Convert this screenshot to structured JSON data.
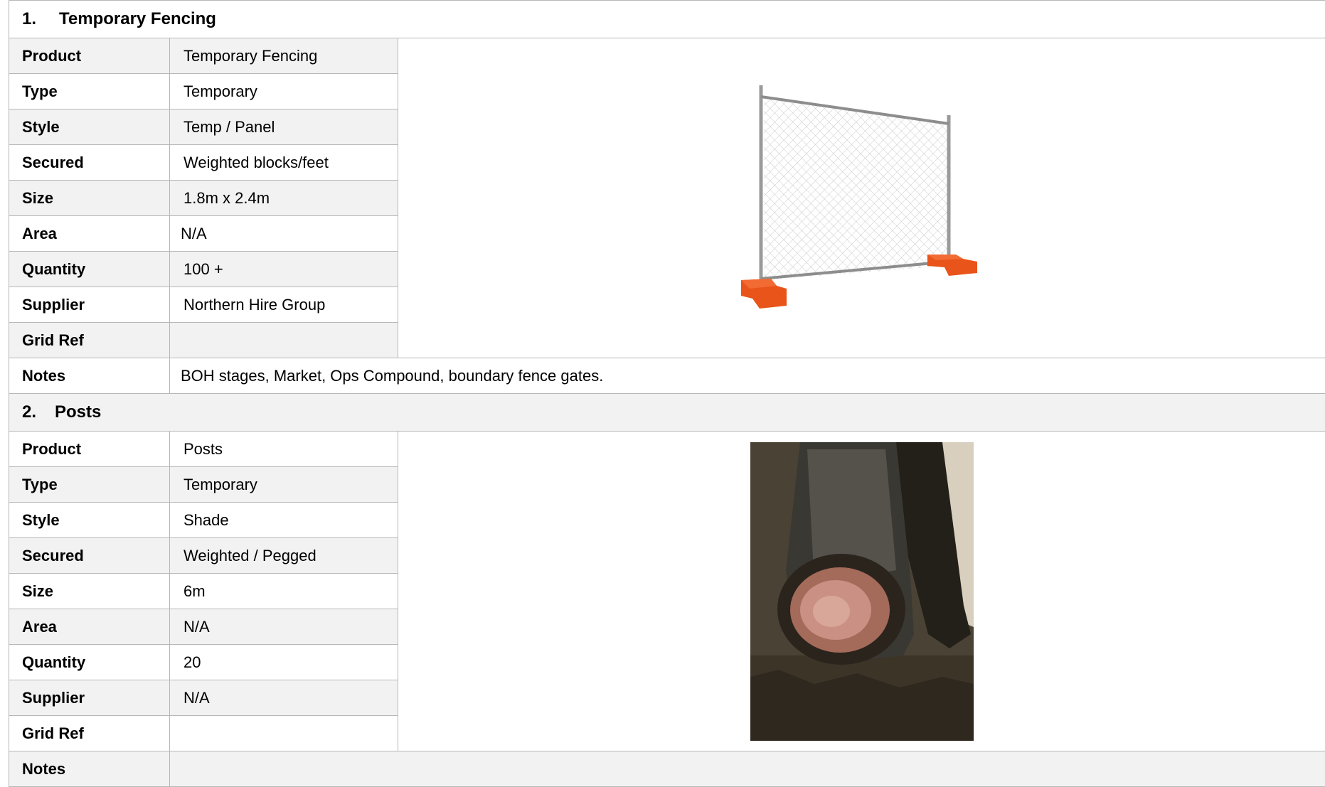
{
  "sections": [
    {
      "number": "1.",
      "title": "Temporary Fencing",
      "fields": [
        {
          "label": "Product",
          "value": "Temporary Fencing"
        },
        {
          "label": "Type",
          "value": "Temporary"
        },
        {
          "label": "Style",
          "value": "Temp / Panel"
        },
        {
          "label": "Secured",
          "value": "Weighted blocks/feet"
        },
        {
          "label": "Size",
          "value": "1.8m x 2.4m"
        },
        {
          "label": "Area",
          "value": "N/A"
        },
        {
          "label": "Quantity",
          "value": "100 +"
        },
        {
          "label": "Supplier",
          "value": "Northern Hire Group"
        },
        {
          "label": "Grid Ref",
          "value": ""
        }
      ],
      "notes_label": "Notes",
      "notes": "BOH stages, Market, Ops Compound, boundary fence gates.",
      "image_icon": "temporary-fence-panel"
    },
    {
      "number": "2.",
      "title": "Posts",
      "fields": [
        {
          "label": "Product",
          "value": "Posts"
        },
        {
          "label": "Type",
          "value": "Temporary"
        },
        {
          "label": "Style",
          "value": "Shade"
        },
        {
          "label": "Secured",
          "value": "Weighted / Pegged"
        },
        {
          "label": "Size",
          "value": "6m"
        },
        {
          "label": "Area",
          "value": "N/A"
        },
        {
          "label": "Quantity",
          "value": "20"
        },
        {
          "label": "Supplier",
          "value": "N/A"
        },
        {
          "label": "Grid Ref",
          "value": ""
        }
      ],
      "notes_label": "Notes",
      "notes": "",
      "image_icon": "timber-posts-photo"
    }
  ],
  "colors": {
    "shaded_row": "#f2f2f2",
    "border": "#b7b7b7",
    "fence_feet": "#e8541a"
  }
}
